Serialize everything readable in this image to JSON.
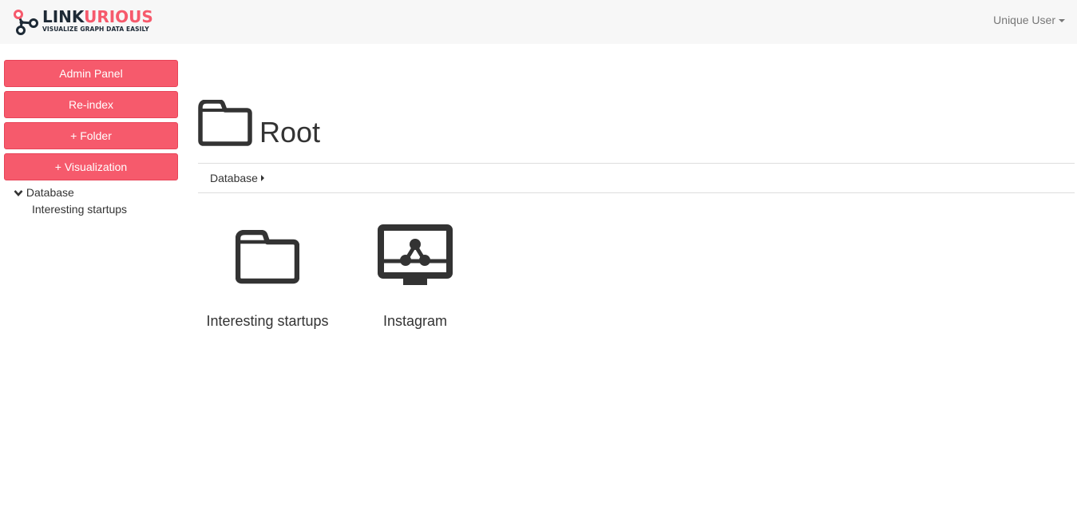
{
  "header": {
    "logo": {
      "name_part1": "LINK",
      "name_part2": "URIOUS",
      "tagline": "VISUALIZE GRAPH DATA EASILY",
      "icon": "graph-nodes-icon"
    },
    "user_menu": {
      "label": "Unique User",
      "icon": "caret-down-icon"
    }
  },
  "sidebar": {
    "buttons": [
      {
        "label": "Admin Panel"
      },
      {
        "label": "Re-index"
      },
      {
        "label": "+ Folder"
      },
      {
        "label": "+ Visualization"
      }
    ],
    "tree": {
      "root": {
        "label": "Database",
        "icon": "chevron-down-icon"
      },
      "children": [
        {
          "label": "Interesting startups"
        }
      ]
    }
  },
  "main": {
    "title": "Root",
    "title_icon": "folder-icon",
    "breadcrumb": {
      "label": "Database",
      "icon": "caret-right-icon"
    },
    "items": [
      {
        "label": "Interesting startups",
        "type": "folder",
        "icon": "folder-icon"
      },
      {
        "label": "Instagram",
        "type": "visualization",
        "icon": "graph-visualization-icon"
      }
    ]
  },
  "colors": {
    "accent": "#f65a6c",
    "accent_border": "#e84458",
    "topbar_bg": "#f7f7f7",
    "text": "#333333",
    "muted": "#777777",
    "icon": "#333333"
  }
}
